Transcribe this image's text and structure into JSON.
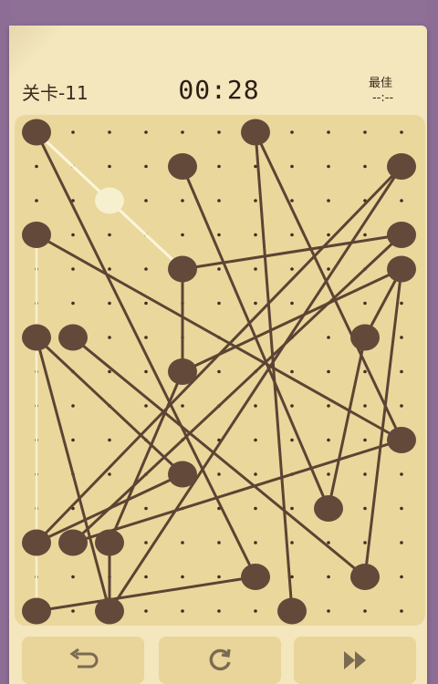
{
  "header": {
    "level_label": "关卡-11",
    "timer": "00:28",
    "best_label": "最佳",
    "best_value": "--:--"
  },
  "controls": {
    "undo_icon": "undo-icon",
    "restart_icon": "restart-icon",
    "skip_icon": "skip-icon"
  },
  "colors": {
    "node": "#62493a",
    "edge": "#5b4433",
    "active_edge": "#fbf6dc",
    "selected_node": "#f6f0cf",
    "board": "#ead79c",
    "card": "#f4e6bd",
    "background": "#8e6f96"
  },
  "game": {
    "grid": {
      "cols": 11,
      "rows": 15
    },
    "nodes": [
      {
        "id": "a",
        "col": 0,
        "row": 0
      },
      {
        "id": "b",
        "col": 6,
        "row": 0
      },
      {
        "id": "c",
        "col": 4,
        "row": 1
      },
      {
        "id": "d",
        "col": 10,
        "row": 1
      },
      {
        "id": "e",
        "col": 0,
        "row": 3
      },
      {
        "id": "f",
        "col": 10,
        "row": 3
      },
      {
        "id": "g",
        "col": 4,
        "row": 4
      },
      {
        "id": "h",
        "col": 10,
        "row": 4
      },
      {
        "id": "i",
        "col": 0,
        "row": 6
      },
      {
        "id": "j",
        "col": 1,
        "row": 6
      },
      {
        "id": "k",
        "col": 9,
        "row": 6
      },
      {
        "id": "l",
        "col": 4,
        "row": 7
      },
      {
        "id": "m",
        "col": 10,
        "row": 9
      },
      {
        "id": "n",
        "col": 4,
        "row": 10
      },
      {
        "id": "o",
        "col": 8,
        "row": 11
      },
      {
        "id": "p",
        "col": 0,
        "row": 12
      },
      {
        "id": "q",
        "col": 1,
        "row": 12
      },
      {
        "id": "r",
        "col": 2,
        "row": 12
      },
      {
        "id": "s",
        "col": 6,
        "row": 13
      },
      {
        "id": "t",
        "col": 9,
        "row": 13
      },
      {
        "id": "u",
        "col": 0,
        "row": 14
      },
      {
        "id": "v",
        "col": 2,
        "row": 14
      },
      {
        "id": "w",
        "col": 7,
        "row": 14
      }
    ],
    "selected_node": {
      "col": 2,
      "row": 2
    },
    "active_edges": [
      [
        "a",
        "sel"
      ],
      [
        "sel",
        "g"
      ]
    ],
    "edges": [
      [
        "a",
        "s"
      ],
      [
        "b",
        "w"
      ],
      [
        "b",
        "m"
      ],
      [
        "c",
        "o"
      ],
      [
        "d",
        "p"
      ],
      [
        "d",
        "v"
      ],
      [
        "e",
        "m"
      ],
      [
        "f",
        "q"
      ],
      [
        "g",
        "l"
      ],
      [
        "h",
        "k"
      ],
      [
        "i",
        "n"
      ],
      [
        "i",
        "v"
      ],
      [
        "j",
        "t"
      ],
      [
        "k",
        "o"
      ],
      [
        "l",
        "r"
      ],
      [
        "l",
        "h"
      ],
      [
        "m",
        "q"
      ],
      [
        "n",
        "p"
      ],
      [
        "r",
        "v"
      ],
      [
        "u",
        "s"
      ],
      [
        "g",
        "f"
      ],
      [
        "t",
        "h"
      ]
    ],
    "ghost_edges": [
      [
        "e",
        "u"
      ]
    ]
  }
}
